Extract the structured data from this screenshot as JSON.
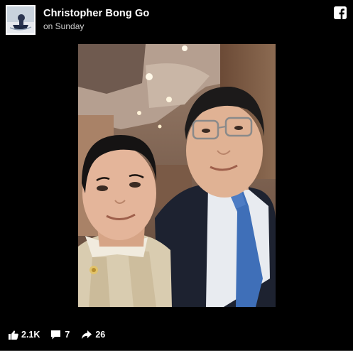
{
  "post": {
    "author_name": "Christopher Bong Go",
    "timestamp": "on Sunday",
    "avatar_icon": "profile-photo",
    "brand_icon": "facebook-logo-icon",
    "brand_color": "#ffffff",
    "background_color": "#000000"
  },
  "photo": {
    "subject": "selfie-photo"
  },
  "engagement": {
    "likes_icon": "thumbs-up-icon",
    "likes_count": "2.1K",
    "comments_icon": "comment-icon",
    "comments_count": "7",
    "shares_icon": "share-arrow-icon",
    "shares_count": "26"
  }
}
